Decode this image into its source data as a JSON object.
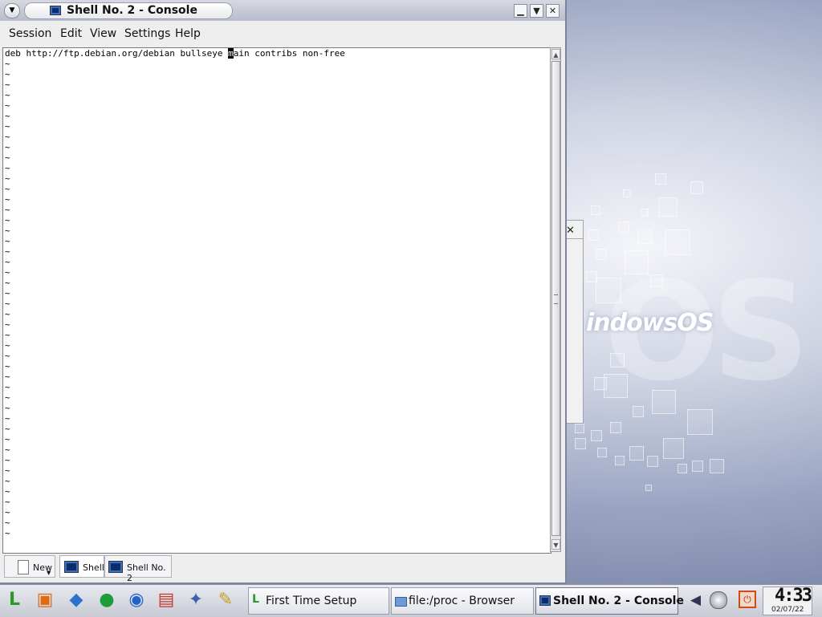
{
  "desktop": {
    "wallpaper_logo": "indowsOS",
    "wallpaper_big": "OS"
  },
  "window": {
    "title": "Shell No. 2 - Console",
    "controls": {
      "minimize": "▁",
      "maximize": "▼",
      "close": "✕"
    }
  },
  "menubar": {
    "items": [
      "Session",
      "Edit",
      "View",
      "Settings",
      "Help"
    ]
  },
  "terminal": {
    "line_before_cursor": "deb http://ftp.debian.org/debian bullseye ",
    "cursor_char": "m",
    "line_after_cursor": "ain contribs non-free",
    "empty_line_marker": "~"
  },
  "session_tabs": {
    "new_label": "New",
    "tabs": [
      "Shell",
      "Shell No. 2"
    ]
  },
  "taskbar": {
    "tasks": [
      {
        "label": "First Time Setup",
        "icon": "setup-icon"
      },
      {
        "label": "file:/proc - Browser",
        "icon": "folder-icon"
      },
      {
        "label": "Shell No. 2 - Console",
        "icon": "terminal-icon"
      }
    ],
    "clock": {
      "time": "4:33",
      "date": "02/07/22"
    }
  },
  "colors": {
    "title_active": "#111111",
    "terminal_bg": "#ffffff",
    "taskbar_bg": "#dcdde4"
  }
}
